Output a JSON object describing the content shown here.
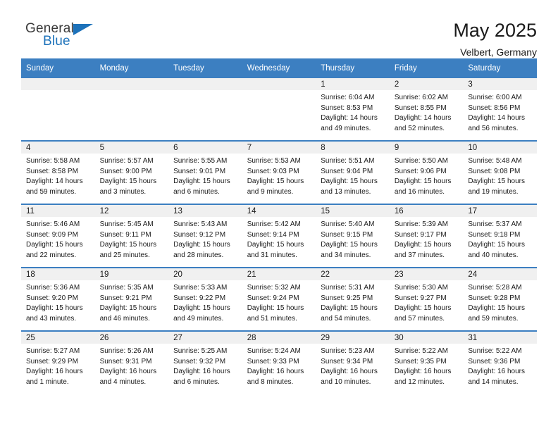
{
  "brand": {
    "name_top": "General",
    "name_bottom": "Blue",
    "color_primary": "#1d72ba",
    "color_text": "#3b3b3b",
    "triangle_icon": "triangle-icon"
  },
  "header": {
    "title": "May 2025",
    "subtitle": "Velbert, Germany"
  },
  "theme": {
    "header_bg": "#3c7fc1",
    "header_text": "#ffffff",
    "daynum_band_bg": "#f0f0f0",
    "row_divider": "#3c7fc1"
  },
  "weekdays": [
    "Sunday",
    "Monday",
    "Tuesday",
    "Wednesday",
    "Thursday",
    "Friday",
    "Saturday"
  ],
  "labels": {
    "sunrise_prefix": "Sunrise:",
    "sunset_prefix": "Sunset:",
    "daylight_prefix": "Daylight:"
  },
  "weeks": [
    [
      {
        "day": "",
        "empty": true
      },
      {
        "day": "",
        "empty": true
      },
      {
        "day": "",
        "empty": true
      },
      {
        "day": "",
        "empty": true
      },
      {
        "day": "1",
        "sunrise": "Sunrise: 6:04 AM",
        "sunset": "Sunset: 8:53 PM",
        "daylight_line1": "Daylight: 14 hours",
        "daylight_line2": "and 49 minutes."
      },
      {
        "day": "2",
        "sunrise": "Sunrise: 6:02 AM",
        "sunset": "Sunset: 8:55 PM",
        "daylight_line1": "Daylight: 14 hours",
        "daylight_line2": "and 52 minutes."
      },
      {
        "day": "3",
        "sunrise": "Sunrise: 6:00 AM",
        "sunset": "Sunset: 8:56 PM",
        "daylight_line1": "Daylight: 14 hours",
        "daylight_line2": "and 56 minutes."
      }
    ],
    [
      {
        "day": "4",
        "sunrise": "Sunrise: 5:58 AM",
        "sunset": "Sunset: 8:58 PM",
        "daylight_line1": "Daylight: 14 hours",
        "daylight_line2": "and 59 minutes."
      },
      {
        "day": "5",
        "sunrise": "Sunrise: 5:57 AM",
        "sunset": "Sunset: 9:00 PM",
        "daylight_line1": "Daylight: 15 hours",
        "daylight_line2": "and 3 minutes."
      },
      {
        "day": "6",
        "sunrise": "Sunrise: 5:55 AM",
        "sunset": "Sunset: 9:01 PM",
        "daylight_line1": "Daylight: 15 hours",
        "daylight_line2": "and 6 minutes."
      },
      {
        "day": "7",
        "sunrise": "Sunrise: 5:53 AM",
        "sunset": "Sunset: 9:03 PM",
        "daylight_line1": "Daylight: 15 hours",
        "daylight_line2": "and 9 minutes."
      },
      {
        "day": "8",
        "sunrise": "Sunrise: 5:51 AM",
        "sunset": "Sunset: 9:04 PM",
        "daylight_line1": "Daylight: 15 hours",
        "daylight_line2": "and 13 minutes."
      },
      {
        "day": "9",
        "sunrise": "Sunrise: 5:50 AM",
        "sunset": "Sunset: 9:06 PM",
        "daylight_line1": "Daylight: 15 hours",
        "daylight_line2": "and 16 minutes."
      },
      {
        "day": "10",
        "sunrise": "Sunrise: 5:48 AM",
        "sunset": "Sunset: 9:08 PM",
        "daylight_line1": "Daylight: 15 hours",
        "daylight_line2": "and 19 minutes."
      }
    ],
    [
      {
        "day": "11",
        "sunrise": "Sunrise: 5:46 AM",
        "sunset": "Sunset: 9:09 PM",
        "daylight_line1": "Daylight: 15 hours",
        "daylight_line2": "and 22 minutes."
      },
      {
        "day": "12",
        "sunrise": "Sunrise: 5:45 AM",
        "sunset": "Sunset: 9:11 PM",
        "daylight_line1": "Daylight: 15 hours",
        "daylight_line2": "and 25 minutes."
      },
      {
        "day": "13",
        "sunrise": "Sunrise: 5:43 AM",
        "sunset": "Sunset: 9:12 PM",
        "daylight_line1": "Daylight: 15 hours",
        "daylight_line2": "and 28 minutes."
      },
      {
        "day": "14",
        "sunrise": "Sunrise: 5:42 AM",
        "sunset": "Sunset: 9:14 PM",
        "daylight_line1": "Daylight: 15 hours",
        "daylight_line2": "and 31 minutes."
      },
      {
        "day": "15",
        "sunrise": "Sunrise: 5:40 AM",
        "sunset": "Sunset: 9:15 PM",
        "daylight_line1": "Daylight: 15 hours",
        "daylight_line2": "and 34 minutes."
      },
      {
        "day": "16",
        "sunrise": "Sunrise: 5:39 AM",
        "sunset": "Sunset: 9:17 PM",
        "daylight_line1": "Daylight: 15 hours",
        "daylight_line2": "and 37 minutes."
      },
      {
        "day": "17",
        "sunrise": "Sunrise: 5:37 AM",
        "sunset": "Sunset: 9:18 PM",
        "daylight_line1": "Daylight: 15 hours",
        "daylight_line2": "and 40 minutes."
      }
    ],
    [
      {
        "day": "18",
        "sunrise": "Sunrise: 5:36 AM",
        "sunset": "Sunset: 9:20 PM",
        "daylight_line1": "Daylight: 15 hours",
        "daylight_line2": "and 43 minutes."
      },
      {
        "day": "19",
        "sunrise": "Sunrise: 5:35 AM",
        "sunset": "Sunset: 9:21 PM",
        "daylight_line1": "Daylight: 15 hours",
        "daylight_line2": "and 46 minutes."
      },
      {
        "day": "20",
        "sunrise": "Sunrise: 5:33 AM",
        "sunset": "Sunset: 9:22 PM",
        "daylight_line1": "Daylight: 15 hours",
        "daylight_line2": "and 49 minutes."
      },
      {
        "day": "21",
        "sunrise": "Sunrise: 5:32 AM",
        "sunset": "Sunset: 9:24 PM",
        "daylight_line1": "Daylight: 15 hours",
        "daylight_line2": "and 51 minutes."
      },
      {
        "day": "22",
        "sunrise": "Sunrise: 5:31 AM",
        "sunset": "Sunset: 9:25 PM",
        "daylight_line1": "Daylight: 15 hours",
        "daylight_line2": "and 54 minutes."
      },
      {
        "day": "23",
        "sunrise": "Sunrise: 5:30 AM",
        "sunset": "Sunset: 9:27 PM",
        "daylight_line1": "Daylight: 15 hours",
        "daylight_line2": "and 57 minutes."
      },
      {
        "day": "24",
        "sunrise": "Sunrise: 5:28 AM",
        "sunset": "Sunset: 9:28 PM",
        "daylight_line1": "Daylight: 15 hours",
        "daylight_line2": "and 59 minutes."
      }
    ],
    [
      {
        "day": "25",
        "sunrise": "Sunrise: 5:27 AM",
        "sunset": "Sunset: 9:29 PM",
        "daylight_line1": "Daylight: 16 hours",
        "daylight_line2": "and 1 minute."
      },
      {
        "day": "26",
        "sunrise": "Sunrise: 5:26 AM",
        "sunset": "Sunset: 9:31 PM",
        "daylight_line1": "Daylight: 16 hours",
        "daylight_line2": "and 4 minutes."
      },
      {
        "day": "27",
        "sunrise": "Sunrise: 5:25 AM",
        "sunset": "Sunset: 9:32 PM",
        "daylight_line1": "Daylight: 16 hours",
        "daylight_line2": "and 6 minutes."
      },
      {
        "day": "28",
        "sunrise": "Sunrise: 5:24 AM",
        "sunset": "Sunset: 9:33 PM",
        "daylight_line1": "Daylight: 16 hours",
        "daylight_line2": "and 8 minutes."
      },
      {
        "day": "29",
        "sunrise": "Sunrise: 5:23 AM",
        "sunset": "Sunset: 9:34 PM",
        "daylight_line1": "Daylight: 16 hours",
        "daylight_line2": "and 10 minutes."
      },
      {
        "day": "30",
        "sunrise": "Sunrise: 5:22 AM",
        "sunset": "Sunset: 9:35 PM",
        "daylight_line1": "Daylight: 16 hours",
        "daylight_line2": "and 12 minutes."
      },
      {
        "day": "31",
        "sunrise": "Sunrise: 5:22 AM",
        "sunset": "Sunset: 9:36 PM",
        "daylight_line1": "Daylight: 16 hours",
        "daylight_line2": "and 14 minutes."
      }
    ]
  ]
}
